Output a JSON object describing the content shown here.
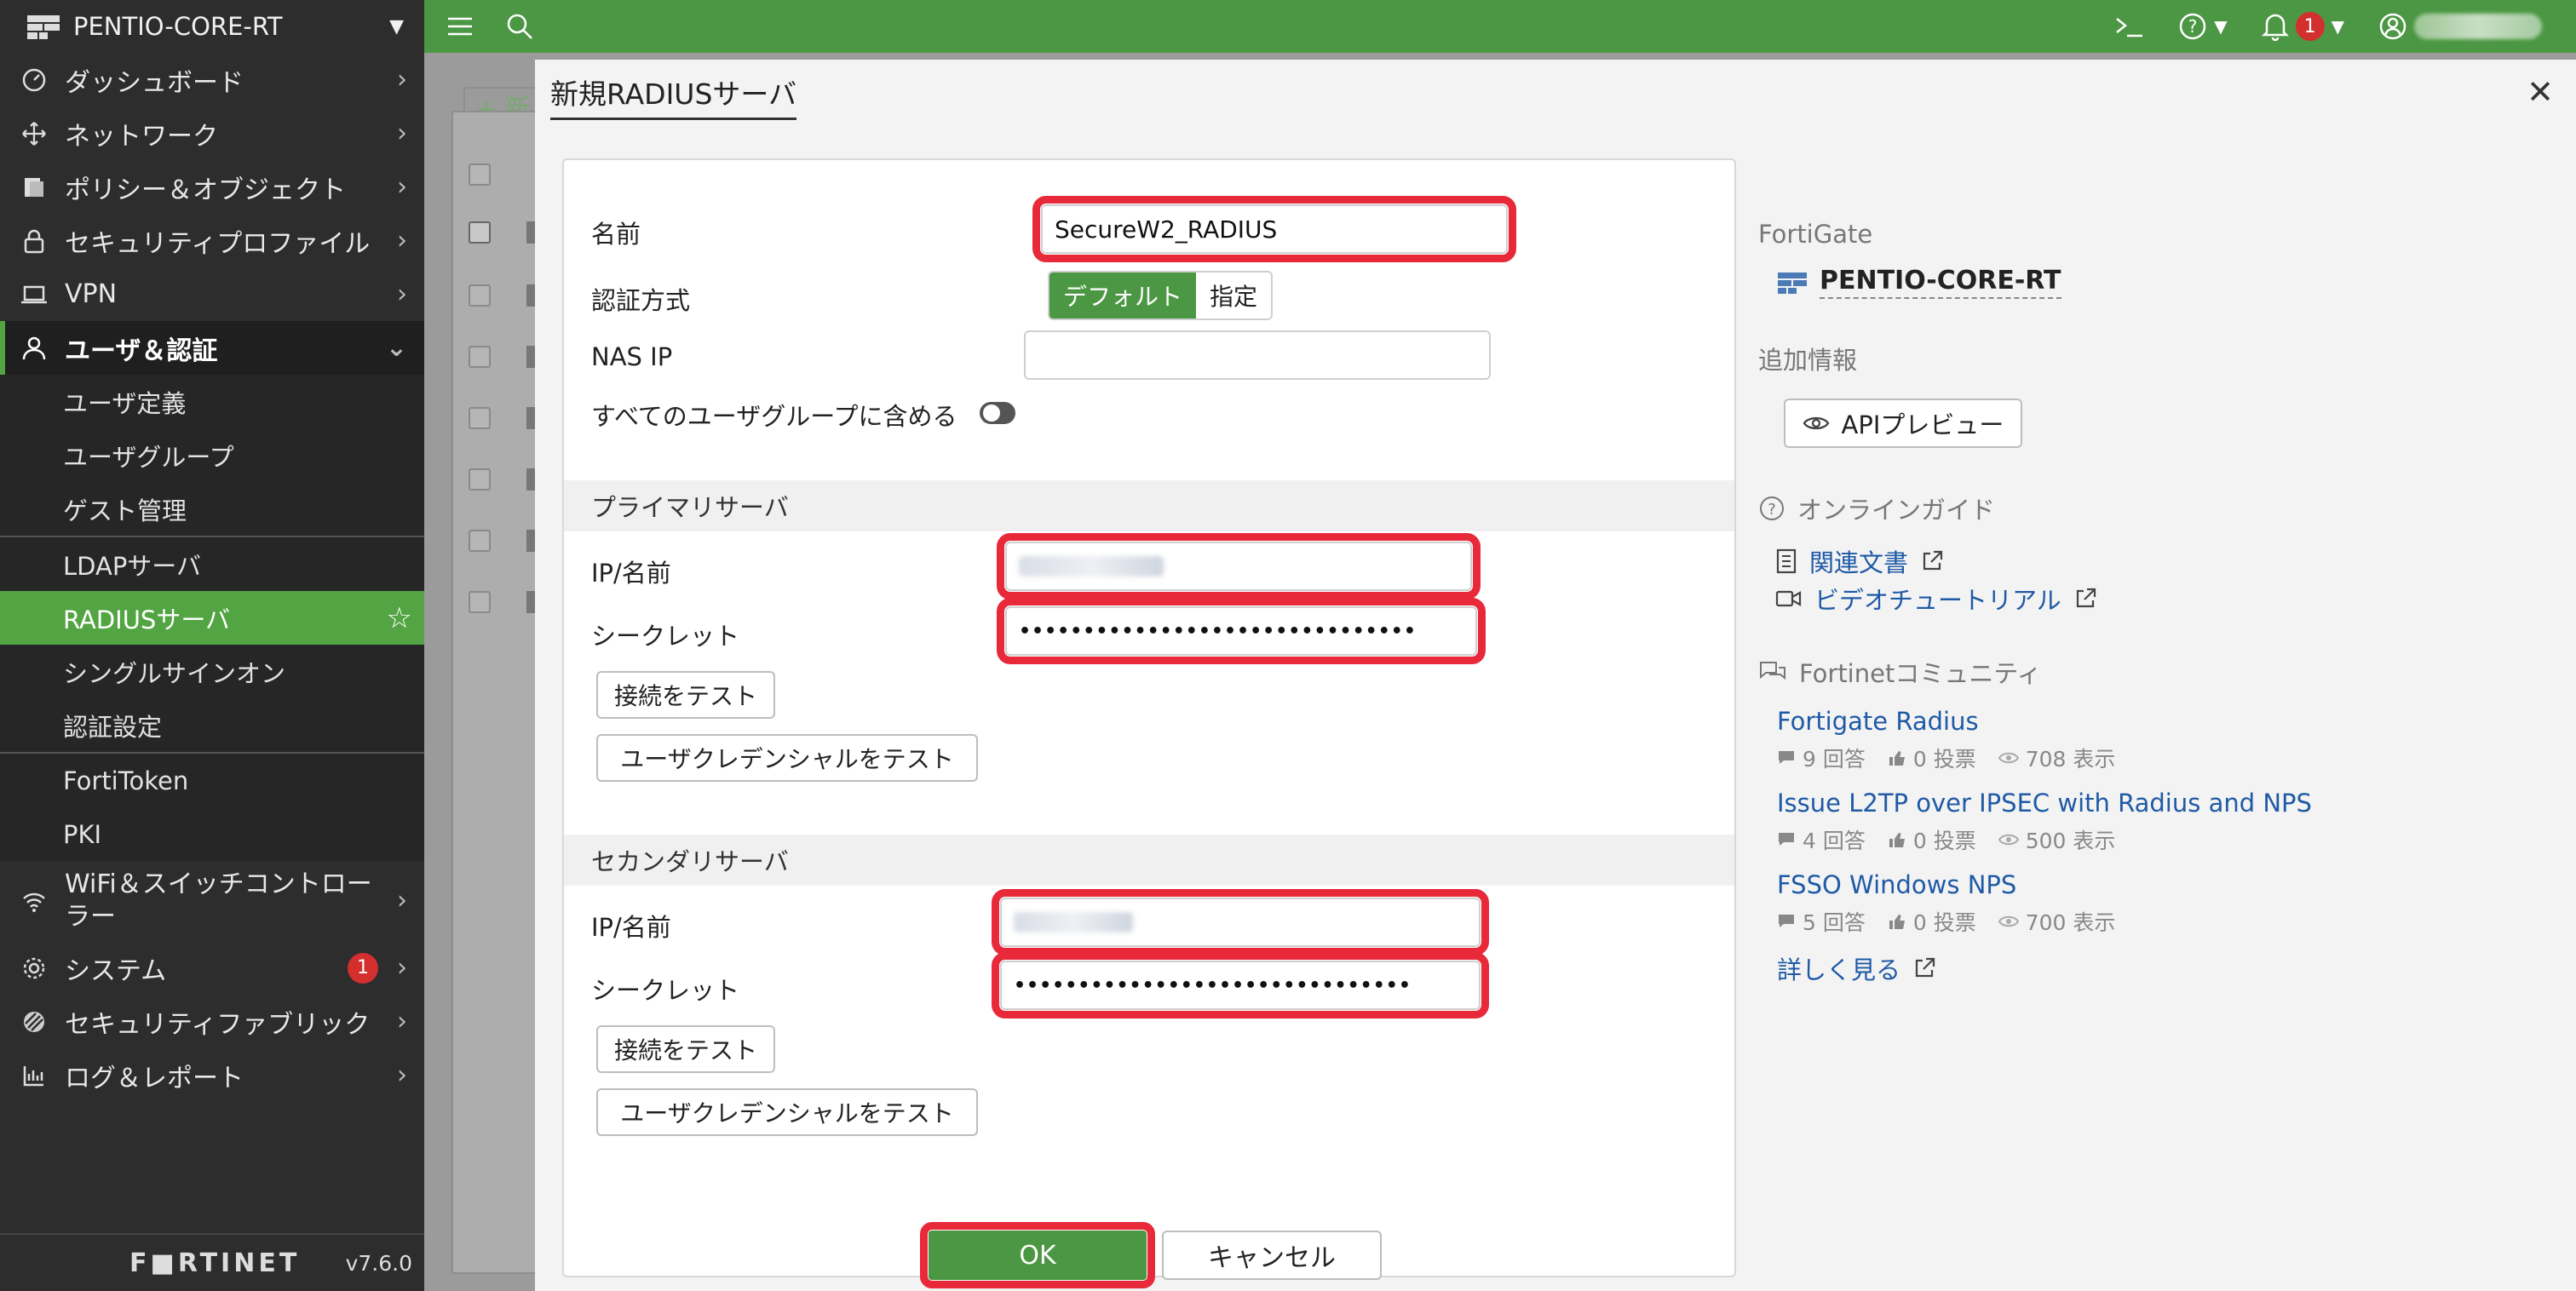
{
  "sidebar": {
    "device_name": "PENTIO-CORE-RT",
    "items": [
      {
        "label": "ダッシュボード"
      },
      {
        "label": "ネットワーク"
      },
      {
        "label": "ポリシー＆オブジェクト"
      },
      {
        "label": "セキュリティプロファイル"
      },
      {
        "label": "VPN"
      },
      {
        "label": "ユーザ＆認証"
      }
    ],
    "sub_user": [
      "ユーザ定義",
      "ユーザグループ",
      "ゲスト管理"
    ],
    "sub_server": [
      "LDAPサーバ",
      "RADIUSサーバ",
      "シングルサインオン",
      "認証設定"
    ],
    "sub_token": [
      "FortiToken",
      "PKI"
    ],
    "bottom_items": [
      {
        "label_line1": "WiFi＆スイッチコントロー",
        "label_line2": "ラー"
      },
      {
        "label": "システム",
        "badge": "1"
      },
      {
        "label": "セキュリティファブリック"
      },
      {
        "label": "ログ＆レポート"
      }
    ],
    "logo": "F■RTINET",
    "version": "v7.6.0"
  },
  "topbar": {
    "notification_count": "1"
  },
  "background": {
    "new_button": "+ 新"
  },
  "modal": {
    "title": "新規RADIUSサーバ",
    "name_label": "名前",
    "name_value": "SecureW2_RADIUS",
    "auth_method_label": "認証方式",
    "auth_default": "デフォルト",
    "auth_specify": "指定",
    "nas_ip_label": "NAS IP",
    "nas_ip_value": "",
    "include_all_groups_label": "すべてのユーザグループに含める",
    "primary": {
      "heading": "プライマリサーバ",
      "ip_label": "IP/名前",
      "secret_label": "シークレット",
      "secret_value": "•••••••••••••••••••••••••••••••",
      "test_conn": "接続をテスト",
      "test_cred": "ユーザクレデンシャルをテスト"
    },
    "secondary": {
      "heading": "セカンダリサーバ",
      "ip_label": "IP/名前",
      "secret_label": "シークレット",
      "secret_value": "•••••••••••••••••••••••••••••••",
      "test_conn": "接続をテスト",
      "test_cred": "ユーザクレデンシャルをテスト"
    },
    "ok": "OK",
    "cancel": "キャンセル"
  },
  "info": {
    "fortigate_label": "FortiGate",
    "device": "PENTIO-CORE-RT",
    "additional_info": "追加情報",
    "api_preview": "APIプレビュー",
    "online_guide": "オンラインガイド",
    "related_docs": "関連文書",
    "video_tutorial": "ビデオチュートリアル",
    "community": "Fortinetコミュニティ",
    "posts": [
      {
        "title": "Fortigate Radius",
        "answers": "9 回答",
        "votes": "0 投票",
        "views": "708 表示"
      },
      {
        "title": "Issue L2TP over IPSEC with Radius and NPS",
        "answers": "4 回答",
        "votes": "0 投票",
        "views": "500 表示"
      },
      {
        "title": "FSSO Windows NPS",
        "answers": "5 回答",
        "votes": "0 投票",
        "views": "700 表示"
      }
    ],
    "more": "詳しく見る"
  },
  "colors": {
    "brand_green": "#4c9743",
    "highlight_red": "#e8293a",
    "sidebar_bg": "#2d2d2d",
    "link_blue": "#1f5aa6"
  }
}
